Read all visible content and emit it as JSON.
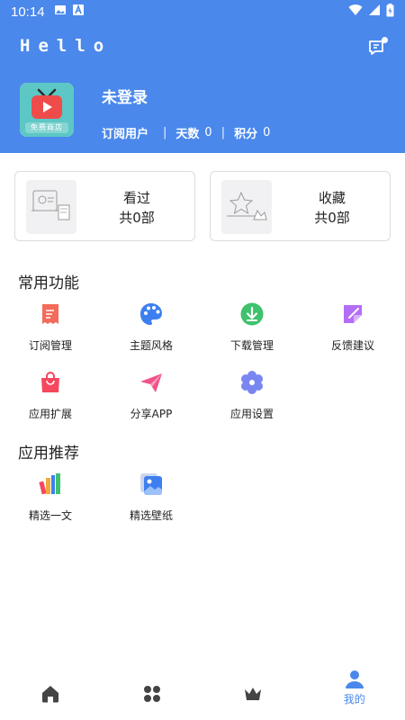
{
  "status_bar": {
    "time": "10:14"
  },
  "header": {
    "app_title": "Hello",
    "logo_text": "免费商店"
  },
  "profile": {
    "username": "未登录",
    "subscription_label": "订阅用户",
    "days_label": "天数",
    "days_value": "0",
    "points_label": "积分",
    "points_value": "0"
  },
  "cards": [
    {
      "title": "看过",
      "subtitle": "共0部"
    },
    {
      "title": "收藏",
      "subtitle": "共0部"
    }
  ],
  "common_functions": {
    "title": "常用功能",
    "items": [
      {
        "label": "订阅管理",
        "icon": "subscription-icon",
        "color": "#f36b5a"
      },
      {
        "label": "主题风格",
        "icon": "palette-icon",
        "color": "#3d7ff0"
      },
      {
        "label": "下载管理",
        "icon": "download-icon",
        "color": "#3ec26c"
      },
      {
        "label": "反馈建议",
        "icon": "feedback-icon",
        "color": "#b46ef6"
      },
      {
        "label": "应用扩展",
        "icon": "bag-icon",
        "color": "#f5475d"
      },
      {
        "label": "分享APP",
        "icon": "paper-plane-icon",
        "color": "#f2528a"
      },
      {
        "label": "应用设置",
        "icon": "settings-flower-icon",
        "color": "#7a86f0"
      }
    ]
  },
  "recommend": {
    "title": "应用推荐",
    "items": [
      {
        "label": "精选一文",
        "icon": "books-icon"
      },
      {
        "label": "精选壁纸",
        "icon": "wallpaper-icon"
      }
    ]
  },
  "tabbar": {
    "active_label": "我的",
    "accent": "#4a88ec"
  },
  "colors": {
    "brand": "#4a88ec"
  }
}
